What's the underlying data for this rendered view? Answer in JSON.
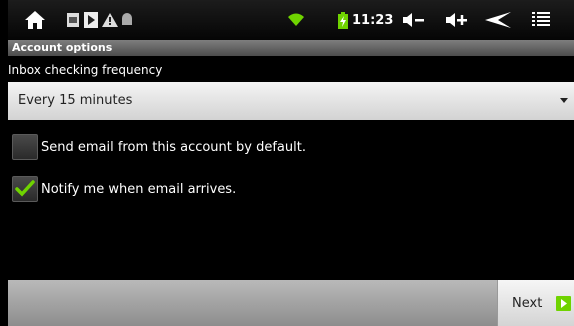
{
  "status_bar": {
    "time": "11:23",
    "icons": [
      "home-icon",
      "screenshot-icon",
      "play-store-icon",
      "warning-icon",
      "android-debug-icon",
      "wifi-icon",
      "battery-charging-icon",
      "volume-down-icon",
      "volume-up-icon",
      "back-icon",
      "menu-icon"
    ],
    "accent_color": "#6fd300"
  },
  "account_options": {
    "header": "Account options",
    "inbox_frequency": {
      "label": "Inbox checking frequency",
      "selected": "Every 15 minutes"
    },
    "default_account": {
      "label": "Send email from this account by default.",
      "checked": false
    },
    "notify": {
      "label": "Notify me when email arrives.",
      "checked": true
    }
  },
  "footer": {
    "next_label": "Next"
  }
}
